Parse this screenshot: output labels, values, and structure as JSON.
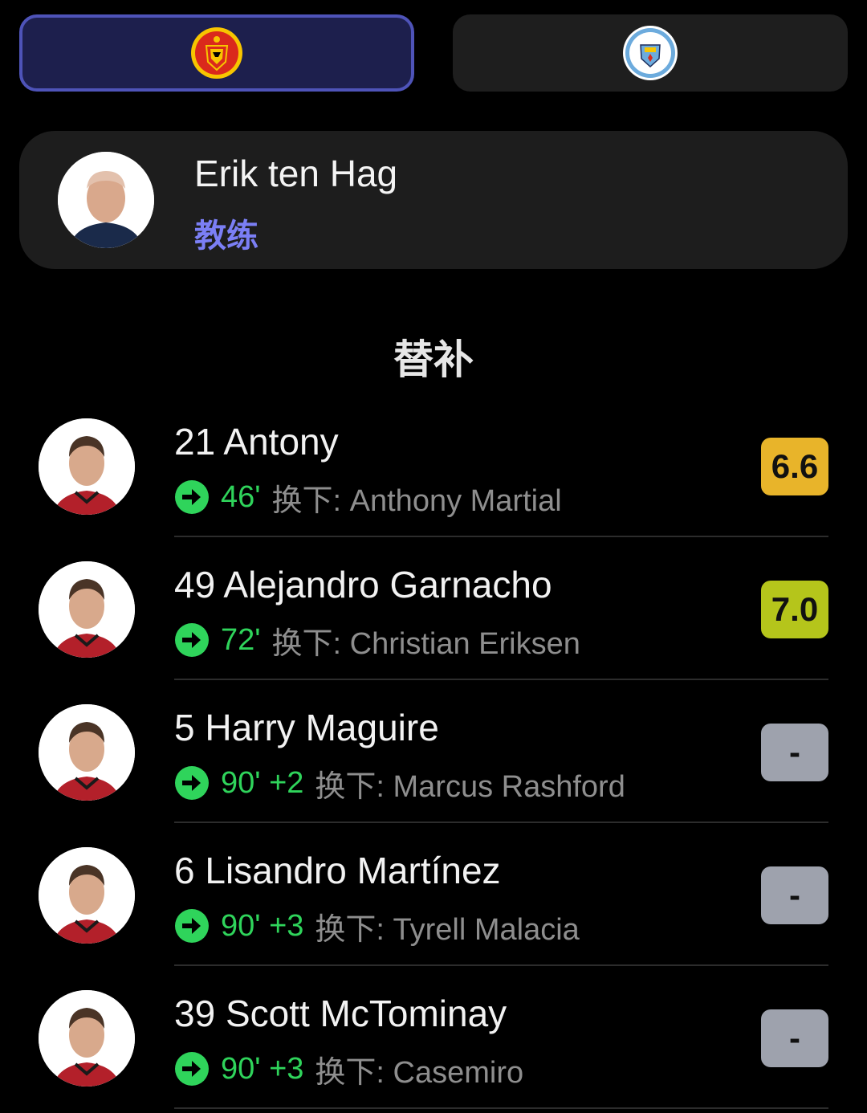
{
  "teams": {
    "home": {
      "name": "MANCHESTER UNITED",
      "crest_icon": "man-utd-crest",
      "selected": true
    },
    "away": {
      "name": "MANCHESTER CITY",
      "crest_icon": "man-city-crest",
      "selected": false
    }
  },
  "coach": {
    "name": "Erik ten Hag",
    "role": "教练"
  },
  "section_title": "替补",
  "substitutes": [
    {
      "number": "21",
      "name": "Antony",
      "display": "21 Antony",
      "minute": "46'",
      "off_label": "换下: Anthony Martial",
      "rating": "6.6",
      "rating_color": "#e8b42a"
    },
    {
      "number": "49",
      "name": "Alejandro Garnacho",
      "display": "49 Alejandro Garnacho",
      "minute": "72'",
      "off_label": "换下: Christian Eriksen",
      "rating": "7.0",
      "rating_color": "#b5c51b"
    },
    {
      "number": "5",
      "name": "Harry Maguire",
      "display": "5 Harry Maguire",
      "minute": "90' +2",
      "off_label": "换下: Marcus Rashford",
      "rating": "-",
      "rating_color": "#9ea2ad"
    },
    {
      "number": "6",
      "name": "Lisandro Martínez",
      "display": "6 Lisandro Martínez",
      "minute": "90' +3",
      "off_label": "换下: Tyrell Malacia",
      "rating": "-",
      "rating_color": "#9ea2ad"
    },
    {
      "number": "39",
      "name": "Scott McTominay",
      "display": "39 Scott McTominay",
      "minute": "90' +3",
      "off_label": "换下: Casemiro",
      "rating": "-",
      "rating_color": "#9ea2ad"
    }
  ],
  "colors": {
    "accent": "#7b7ff5",
    "sub_in_green": "#2fd45b",
    "background": "#000000"
  }
}
